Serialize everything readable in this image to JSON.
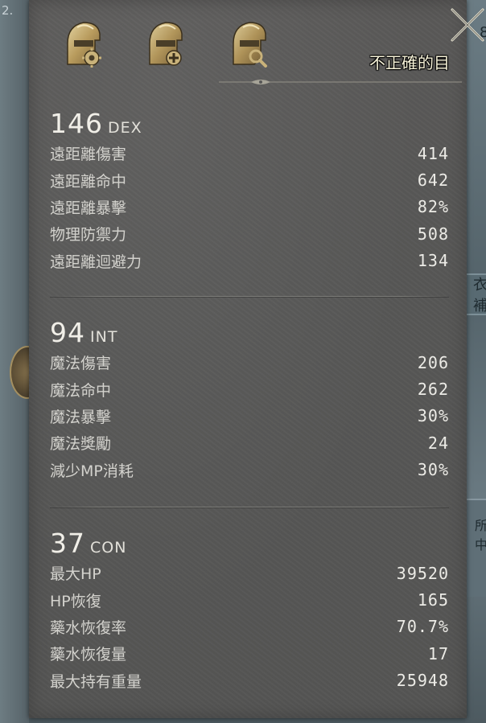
{
  "background": {
    "corner_number": "2.",
    "right_fragment_top": "8",
    "right_fragment_mid": "衣補",
    "right_fragment_low": "所中"
  },
  "header": {
    "icons": [
      "helmet-gear-icon",
      "helmet-plus-icon",
      "helmet-search-icon"
    ],
    "close_icon": "close-x-icon",
    "tooltip": "不正確的目"
  },
  "sections": [
    {
      "value": "146",
      "abbr": "DEX",
      "rows": [
        {
          "label": "遠距離傷害",
          "value": "414"
        },
        {
          "label": "遠距離命中",
          "value": "642"
        },
        {
          "label": "遠距離暴擊",
          "value": "82%"
        },
        {
          "label": "物理防禦力",
          "value": "508"
        },
        {
          "label": "遠距離迴避力",
          "value": "134"
        }
      ]
    },
    {
      "value": "94",
      "abbr": "INT",
      "rows": [
        {
          "label": "魔法傷害",
          "value": "206"
        },
        {
          "label": "魔法命中",
          "value": "262"
        },
        {
          "label": "魔法暴擊",
          "value": "30%"
        },
        {
          "label": "魔法獎勵",
          "value": "24"
        },
        {
          "label": "減少MP消耗",
          "value": "30%"
        }
      ]
    },
    {
      "value": "37",
      "abbr": "CON",
      "rows": [
        {
          "label": "最大HP",
          "value": "39520"
        },
        {
          "label": "HP恢復",
          "value": "165"
        },
        {
          "label": "藥水恢復率",
          "value": "70.7%"
        },
        {
          "label": "藥水恢復量",
          "value": "17"
        },
        {
          "label": "最大持有重量",
          "value": "25948"
        }
      ]
    }
  ],
  "colors": {
    "panel_bg": "#575756",
    "text_primary": "#f1efe8",
    "text_label": "#d3d2cd",
    "icon_gold": "#c9b27a"
  }
}
